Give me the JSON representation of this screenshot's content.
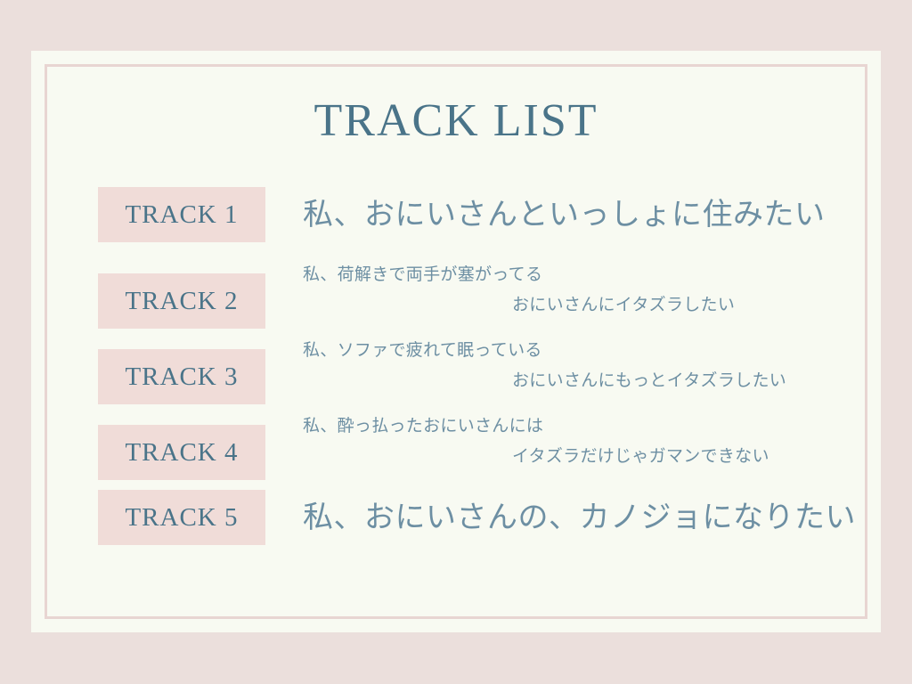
{
  "slide": {
    "title": "TRACK LIST",
    "colors": {
      "page_background": "#ebdfdc",
      "panel_background": "#f8faf2",
      "frame_line": "#e8d5d2",
      "badge_background": "#f0dcd8",
      "title_text": "#4a7489",
      "badge_text": "#4a7489",
      "track_text": "#6d8fa3"
    }
  },
  "tracks": [
    {
      "badge": "TRACK 1",
      "line_1": "私、おにいさんといっしょに住みたい",
      "line_2": "",
      "size": "large"
    },
    {
      "badge": "TRACK 2",
      "line_1": "私、荷解きで両手が塞がってる",
      "line_2": "おにいさんにイタズラしたい",
      "size": "small"
    },
    {
      "badge": "TRACK 3",
      "line_1": "私、ソファで疲れて眠っている",
      "line_2": "おにいさんにもっとイタズラしたい",
      "size": "small"
    },
    {
      "badge": "TRACK 4",
      "line_1": "私、酔っ払ったおにいさんには",
      "line_2": "イタズラだけじゃガマンできない",
      "size": "small"
    },
    {
      "badge": "TRACK 5",
      "line_1": "私、おにいさんの、カノジョになりたい",
      "line_2": "",
      "size": "large"
    }
  ]
}
